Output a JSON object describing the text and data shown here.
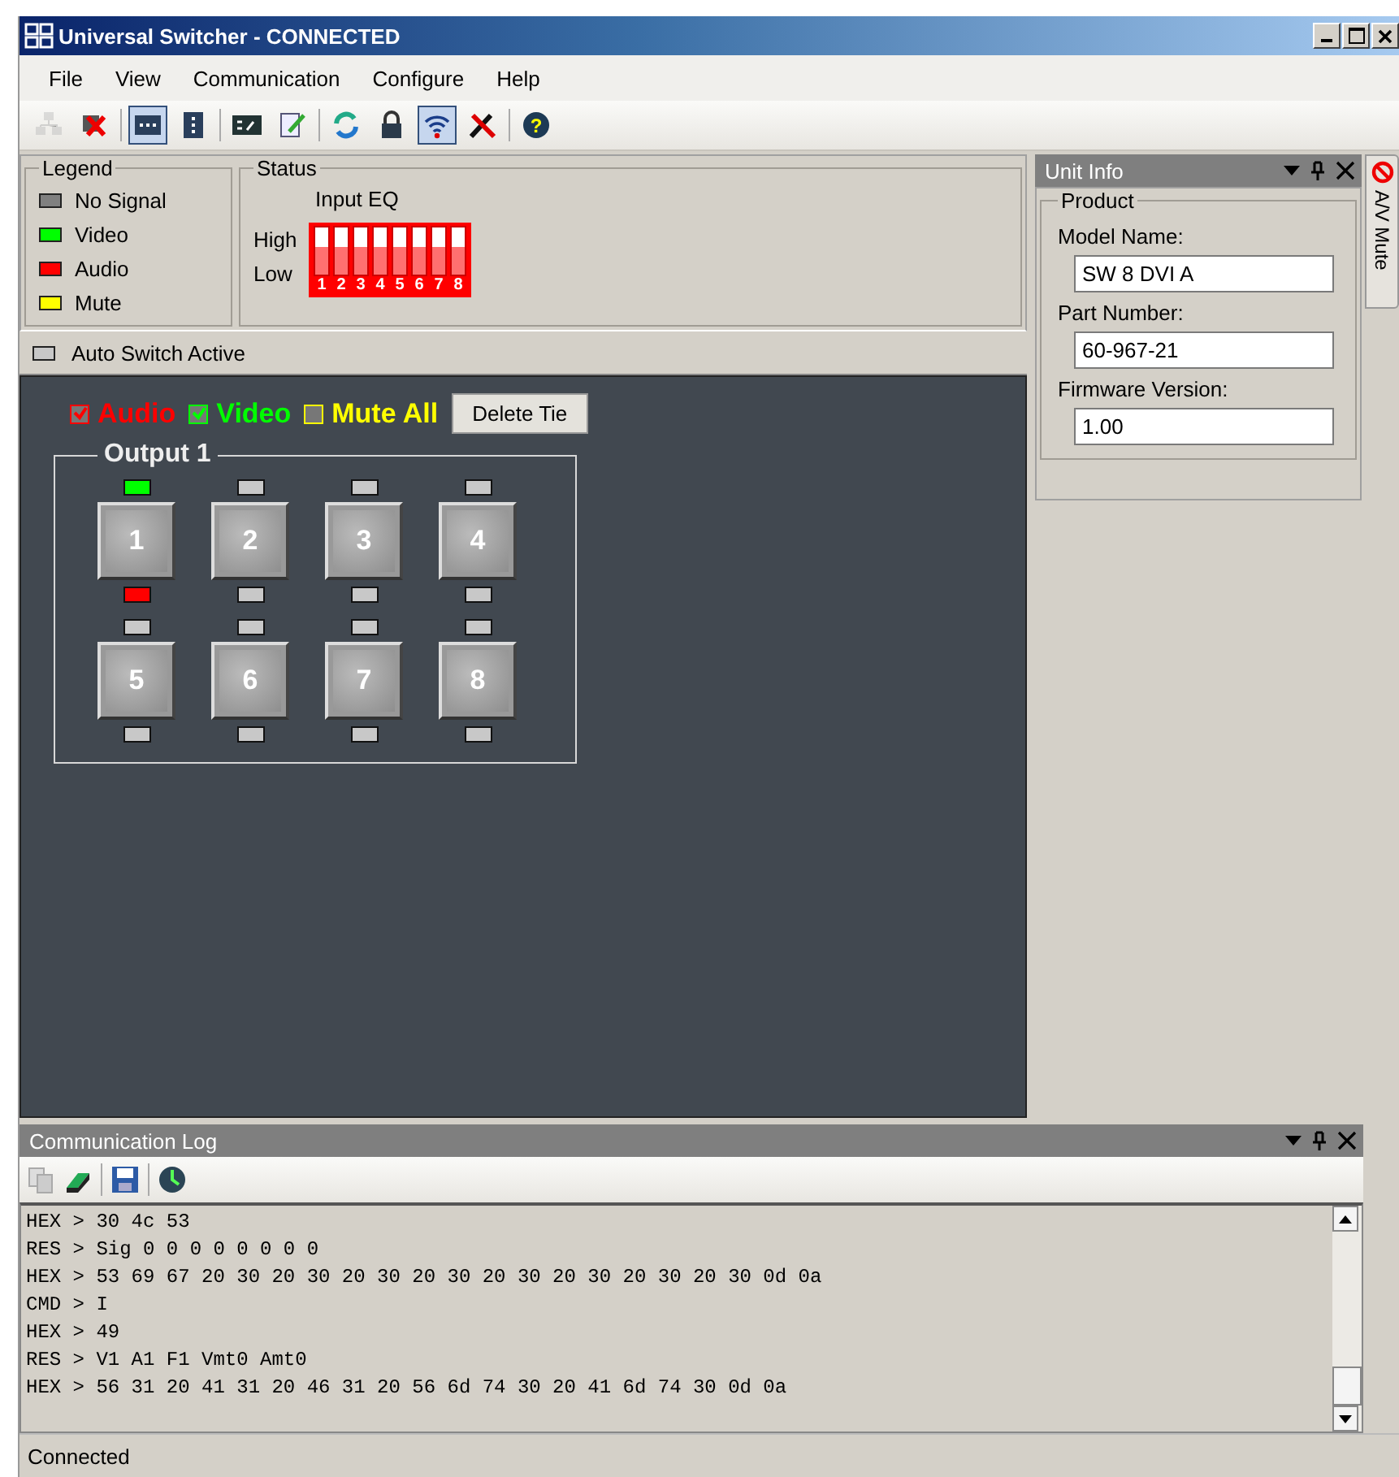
{
  "window": {
    "title": "Universal Switcher - CONNECTED"
  },
  "menu": [
    {
      "label": "File"
    },
    {
      "label": "View"
    },
    {
      "label": "Communication"
    },
    {
      "label": "Configure"
    },
    {
      "label": "Help"
    }
  ],
  "toolbar": [
    {
      "kind": "network",
      "disabled": true,
      "pressed": false
    },
    {
      "kind": "disconnect",
      "disabled": false,
      "pressed": false
    },
    {
      "kind": "rowview",
      "disabled": false,
      "pressed": true
    },
    {
      "kind": "colview",
      "disabled": false,
      "pressed": false
    },
    {
      "kind": "console",
      "disabled": false,
      "pressed": false
    },
    {
      "kind": "edit",
      "disabled": false,
      "pressed": false
    },
    {
      "kind": "refresh",
      "disabled": false,
      "pressed": false
    },
    {
      "kind": "lock",
      "disabled": false,
      "pressed": false
    },
    {
      "kind": "wireless",
      "disabled": false,
      "pressed": true
    },
    {
      "kind": "tools",
      "disabled": false,
      "pressed": false
    },
    {
      "kind": "help",
      "disabled": false,
      "pressed": false,
      "glyph": "?"
    }
  ],
  "legend": {
    "title": "Legend",
    "items": [
      {
        "label": "No Signal",
        "color": "#808080"
      },
      {
        "label": "Video",
        "color": "#00ff00"
      },
      {
        "label": "Audio",
        "color": "#ff0000"
      },
      {
        "label": "Mute",
        "color": "#ffff00"
      }
    ]
  },
  "status": {
    "title": "Status",
    "eq_label": "Input EQ",
    "high_label": "High",
    "low_label": "Low",
    "switches": [
      {
        "label": "1",
        "high": true
      },
      {
        "label": "2",
        "high": true
      },
      {
        "label": "3",
        "high": true
      },
      {
        "label": "4",
        "high": true
      },
      {
        "label": "5",
        "high": true
      },
      {
        "label": "6",
        "high": true
      },
      {
        "label": "7",
        "high": true
      },
      {
        "label": "8",
        "high": true
      }
    ]
  },
  "auto_switch": {
    "label": "Auto Switch Active",
    "on": false
  },
  "tie_options": [
    {
      "label": "Audio",
      "checked": true,
      "color": "#ff0000"
    },
    {
      "label": "Video",
      "checked": true,
      "color": "#00ff00"
    },
    {
      "label": "Mute All",
      "checked": false,
      "color": "#ffff00"
    }
  ],
  "delete_tie": "Delete Tie",
  "output": {
    "title": "Output 1",
    "inputs": [
      {
        "label": "1",
        "video": true,
        "audio": true
      },
      {
        "label": "2",
        "video": false,
        "audio": false
      },
      {
        "label": "3",
        "video": false,
        "audio": false
      },
      {
        "label": "4",
        "video": false,
        "audio": false
      },
      {
        "label": "5",
        "video": false,
        "audio": false
      },
      {
        "label": "6",
        "video": false,
        "audio": false
      },
      {
        "label": "7",
        "video": false,
        "audio": false
      },
      {
        "label": "8",
        "video": false,
        "audio": false
      }
    ]
  },
  "unit_info": {
    "title": "Unit Info",
    "group": "Product",
    "fields": [
      {
        "label": "Model Name:",
        "value": "SW 8 DVI A"
      },
      {
        "label": "Part Number:",
        "value": "60-967-21"
      },
      {
        "label": "Firmware Version:",
        "value": "1.00"
      }
    ]
  },
  "side_tab": {
    "label": "A/V Mute"
  },
  "log": {
    "title": "Communication Log",
    "lines": [
      "HEX > 30 4c 53",
      "RES > Sig 0 0 0 0 0 0 0 0",
      "HEX > 53 69 67 20 30 20 30 20 30 20 30 20 30 20 30 20 30 20 30 0d 0a",
      "CMD > I",
      "HEX > 49",
      "RES > V1 A1 F1 Vmt0 Amt0",
      "HEX > 56 31 20 41 31 20 46 31 20 56 6d 74 30 20 41 6d 74 30 0d 0a"
    ]
  },
  "status_bar": {
    "text": "Connected"
  }
}
